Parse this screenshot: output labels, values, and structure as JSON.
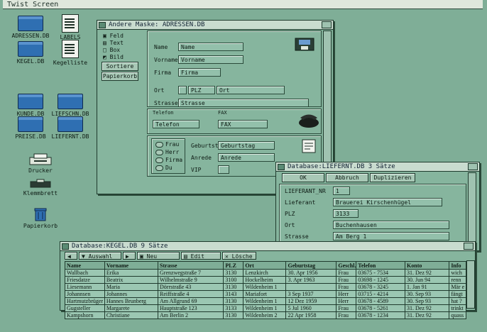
{
  "screen": {
    "title": "Twist Screen"
  },
  "desktop_icons": [
    {
      "label": "ADRESSEN.DB",
      "kind": "drawer"
    },
    {
      "label": "LABELS",
      "kind": "doc"
    },
    {
      "label": "KEGEL.DB",
      "kind": "drawer"
    },
    {
      "label": "Kegelliste",
      "kind": "doc"
    },
    {
      "label": "KUNDE.DB",
      "kind": "drawer"
    },
    {
      "label": "LIEFSCHN.DB",
      "kind": "drawer"
    },
    {
      "label": "PREISE.DB",
      "kind": "drawer"
    },
    {
      "label": "LIEFERNT.DB",
      "kind": "drawer"
    },
    {
      "label": "Drucker",
      "kind": "printer"
    },
    {
      "label": "Klemmbrett",
      "kind": "clipboard"
    },
    {
      "label": "Papierkorb",
      "kind": "trash"
    }
  ],
  "form_window": {
    "title": "Andere Maske: ADRESSEN.DB",
    "tools": [
      "Feld",
      "Text",
      "Box",
      "Bild",
      "Sortiere",
      "Papierkorb"
    ],
    "fields": {
      "name": {
        "label": "Name",
        "value": "Name"
      },
      "vorname": {
        "label": "Vorname",
        "value": "Vorname"
      },
      "firma": {
        "label": "Firma",
        "value": "Firma"
      },
      "ort": {
        "label": "Ort",
        "plz": "PLZ",
        "value": "Ort"
      },
      "strasse": {
        "label": "Strasse",
        "value": "Strasse"
      },
      "telefon": {
        "label": "Telefon",
        "value": "Telefon"
      },
      "fax": {
        "label": "FAX",
        "value": "FAX"
      },
      "geburtstag": {
        "label": "Geburtstag",
        "value": "Geburtstag"
      },
      "anrede": {
        "label": "Anrede",
        "value": "Anrede"
      },
      "vip": {
        "label": "VIP"
      }
    },
    "salutations": [
      "Frau",
      "Herr",
      "Firma",
      "Du"
    ]
  },
  "supplier_window": {
    "title": "Database:LIEFERNT.DB  3 Sätze",
    "buttons": [
      "OK",
      "Abbruch",
      "Duplizieren"
    ],
    "fields": [
      {
        "label": "LIEFERANT_NR",
        "value": "1"
      },
      {
        "label": "Lieferant",
        "value": "Brauerei Kirschenhügel"
      },
      {
        "label": "PLZ",
        "value": "3133"
      },
      {
        "label": "Ort",
        "value": "Buchenhausen"
      },
      {
        "label": "Strasse",
        "value": "Am Berg 1"
      }
    ]
  },
  "table_window": {
    "title": "Database:KEGEL.DB  9 Sätze",
    "toolbar": [
      "Auswahl",
      "Neu",
      "Edit",
      "Lösche"
    ],
    "columns": [
      "Name",
      "Vorname",
      "Strasse",
      "PLZ",
      "Ort",
      "Geburtstag",
      "Geschl.",
      "Telefon",
      "Konto",
      "Info"
    ],
    "rows": [
      [
        "Wallbach",
        "Erika",
        "Grenzwegstraße 7",
        "3130",
        "Lenzkirch",
        "30. Apr 1956",
        "Frau",
        "03675 - 7534",
        "31. Dez 92",
        "wich"
      ],
      [
        "Friesdatze",
        "Beatrix",
        "Wilhelmstraße 9",
        "3100",
        "Hockelheim",
        "3. Apr 1963",
        "Frau",
        "03698 - 1245",
        "30. Jun 94",
        "renn"
      ],
      [
        "Liesemann",
        "Maria",
        "Dörrstraße 43",
        "3130",
        "Wildenheim 1",
        "",
        "Frau",
        "03678 - 3245",
        "1. Jan 91",
        "Mär e"
      ],
      [
        "Johannsen",
        "Johannes",
        "Reiffstraße 4",
        "3143",
        "Mariafort",
        "3 Sep 1937",
        "Herr",
        "03715 - 4214",
        "30. Sep 93",
        "fängt"
      ],
      [
        "Hartmutzbrüger",
        "Hannes Brunberg",
        "Am Allgrund 69",
        "3130",
        "Wildenheim 1",
        "12 Dez 1959",
        "Herr",
        "03678 - 4589",
        "30. Sep 93",
        "hat ?"
      ],
      [
        "Gugsteller",
        "Margarete",
        "Hauptstraße 123",
        "3133",
        "Wildenheim 1",
        "5 Jul 1960",
        "Frau",
        "03678 - 5261",
        "31. Dez 92",
        "trinkt"
      ],
      [
        "Kampshorn",
        "Christiane",
        "Am Berlin 2",
        "3130",
        "Wildenheim 2",
        "22 Apr 1958",
        "Frau",
        "03678 - 1234",
        "31. Dez 92",
        "quass"
      ]
    ]
  }
}
